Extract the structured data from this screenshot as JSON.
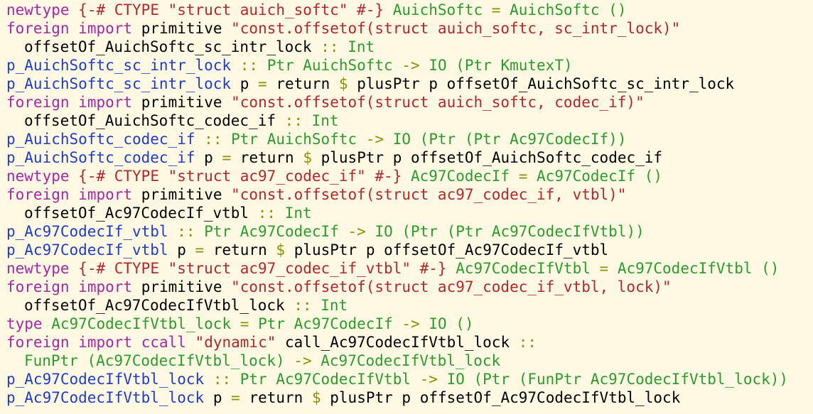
{
  "editor": {
    "lines": [
      {
        "indent": false,
        "tokens": [
          {
            "c": "kw",
            "t": "newtype"
          },
          {
            "c": "pl",
            "t": " "
          },
          {
            "c": "pr",
            "t": "{-# CTYPE \"struct auich_softc\" #-}"
          },
          {
            "c": "pl",
            "t": " "
          },
          {
            "c": "ty",
            "t": "AuichSoftc"
          },
          {
            "c": "pl",
            "t": " "
          },
          {
            "c": "op",
            "t": "="
          },
          {
            "c": "pl",
            "t": " "
          },
          {
            "c": "ty",
            "t": "AuichSoftc ()"
          }
        ]
      },
      {
        "indent": false,
        "tokens": [
          {
            "c": "kw",
            "t": "foreign"
          },
          {
            "c": "pl",
            "t": " "
          },
          {
            "c": "kw",
            "t": "import"
          },
          {
            "c": "pl",
            "t": " "
          },
          {
            "c": "id",
            "t": "primitive"
          },
          {
            "c": "pl",
            "t": " "
          },
          {
            "c": "str",
            "t": "\"const.offsetof(struct auich_softc, sc_intr_lock)\""
          }
        ]
      },
      {
        "indent": true,
        "tokens": [
          {
            "c": "id",
            "t": "offsetOf_AuichSoftc_sc_intr_lock"
          },
          {
            "c": "pl",
            "t": " "
          },
          {
            "c": "op",
            "t": "::"
          },
          {
            "c": "pl",
            "t": " "
          },
          {
            "c": "ty",
            "t": "Int"
          }
        ]
      },
      {
        "indent": false,
        "tokens": [
          {
            "c": "fn",
            "t": "p_AuichSoftc_sc_intr_lock"
          },
          {
            "c": "pl",
            "t": " "
          },
          {
            "c": "op",
            "t": "::"
          },
          {
            "c": "pl",
            "t": " "
          },
          {
            "c": "ty",
            "t": "Ptr AuichSoftc"
          },
          {
            "c": "pl",
            "t": " "
          },
          {
            "c": "op",
            "t": "->"
          },
          {
            "c": "pl",
            "t": " "
          },
          {
            "c": "ty",
            "t": "IO (Ptr KmutexT)"
          }
        ]
      },
      {
        "indent": false,
        "tokens": [
          {
            "c": "fn",
            "t": "p_AuichSoftc_sc_intr_lock"
          },
          {
            "c": "pl",
            "t": " "
          },
          {
            "c": "id",
            "t": "p"
          },
          {
            "c": "pl",
            "t": " "
          },
          {
            "c": "op",
            "t": "="
          },
          {
            "c": "pl",
            "t": " "
          },
          {
            "c": "id",
            "t": "return"
          },
          {
            "c": "pl",
            "t": " "
          },
          {
            "c": "op",
            "t": "$"
          },
          {
            "c": "pl",
            "t": " "
          },
          {
            "c": "id",
            "t": "plusPtr p offsetOf_AuichSoftc_sc_intr_lock"
          }
        ]
      },
      {
        "indent": false,
        "tokens": [
          {
            "c": "kw",
            "t": "foreign"
          },
          {
            "c": "pl",
            "t": " "
          },
          {
            "c": "kw",
            "t": "import"
          },
          {
            "c": "pl",
            "t": " "
          },
          {
            "c": "id",
            "t": "primitive"
          },
          {
            "c": "pl",
            "t": " "
          },
          {
            "c": "str",
            "t": "\"const.offsetof(struct auich_softc, codec_if)\""
          }
        ]
      },
      {
        "indent": true,
        "tokens": [
          {
            "c": "id",
            "t": "offsetOf_AuichSoftc_codec_if"
          },
          {
            "c": "pl",
            "t": " "
          },
          {
            "c": "op",
            "t": "::"
          },
          {
            "c": "pl",
            "t": " "
          },
          {
            "c": "ty",
            "t": "Int"
          }
        ]
      },
      {
        "indent": false,
        "tokens": [
          {
            "c": "fn",
            "t": "p_AuichSoftc_codec_if"
          },
          {
            "c": "pl",
            "t": " "
          },
          {
            "c": "op",
            "t": "::"
          },
          {
            "c": "pl",
            "t": " "
          },
          {
            "c": "ty",
            "t": "Ptr AuichSoftc"
          },
          {
            "c": "pl",
            "t": " "
          },
          {
            "c": "op",
            "t": "->"
          },
          {
            "c": "pl",
            "t": " "
          },
          {
            "c": "ty",
            "t": "IO (Ptr (Ptr Ac97CodecIf))"
          }
        ]
      },
      {
        "indent": false,
        "tokens": [
          {
            "c": "fn",
            "t": "p_AuichSoftc_codec_if"
          },
          {
            "c": "pl",
            "t": " "
          },
          {
            "c": "id",
            "t": "p"
          },
          {
            "c": "pl",
            "t": " "
          },
          {
            "c": "op",
            "t": "="
          },
          {
            "c": "pl",
            "t": " "
          },
          {
            "c": "id",
            "t": "return"
          },
          {
            "c": "pl",
            "t": " "
          },
          {
            "c": "op",
            "t": "$"
          },
          {
            "c": "pl",
            "t": " "
          },
          {
            "c": "id",
            "t": "plusPtr p offsetOf_AuichSoftc_codec_if"
          }
        ]
      },
      {
        "indent": false,
        "tokens": [
          {
            "c": "kw",
            "t": "newtype"
          },
          {
            "c": "pl",
            "t": " "
          },
          {
            "c": "pr",
            "t": "{-# CTYPE \"struct ac97_codec_if\" #-}"
          },
          {
            "c": "pl",
            "t": " "
          },
          {
            "c": "ty",
            "t": "Ac97CodecIf"
          },
          {
            "c": "pl",
            "t": " "
          },
          {
            "c": "op",
            "t": "="
          },
          {
            "c": "pl",
            "t": " "
          },
          {
            "c": "ty",
            "t": "Ac97CodecIf ()"
          }
        ]
      },
      {
        "indent": false,
        "tokens": [
          {
            "c": "kw",
            "t": "foreign"
          },
          {
            "c": "pl",
            "t": " "
          },
          {
            "c": "kw",
            "t": "import"
          },
          {
            "c": "pl",
            "t": " "
          },
          {
            "c": "id",
            "t": "primitive"
          },
          {
            "c": "pl",
            "t": " "
          },
          {
            "c": "str",
            "t": "\"const.offsetof(struct ac97_codec_if, vtbl)\""
          }
        ]
      },
      {
        "indent": true,
        "tokens": [
          {
            "c": "id",
            "t": "offsetOf_Ac97CodecIf_vtbl"
          },
          {
            "c": "pl",
            "t": " "
          },
          {
            "c": "op",
            "t": "::"
          },
          {
            "c": "pl",
            "t": " "
          },
          {
            "c": "ty",
            "t": "Int"
          }
        ]
      },
      {
        "indent": false,
        "tokens": [
          {
            "c": "fn",
            "t": "p_Ac97CodecIf_vtbl"
          },
          {
            "c": "pl",
            "t": " "
          },
          {
            "c": "op",
            "t": "::"
          },
          {
            "c": "pl",
            "t": " "
          },
          {
            "c": "ty",
            "t": "Ptr Ac97CodecIf"
          },
          {
            "c": "pl",
            "t": " "
          },
          {
            "c": "op",
            "t": "->"
          },
          {
            "c": "pl",
            "t": " "
          },
          {
            "c": "ty",
            "t": "IO (Ptr (Ptr Ac97CodecIfVtbl))"
          }
        ]
      },
      {
        "indent": false,
        "tokens": [
          {
            "c": "fn",
            "t": "p_Ac97CodecIf_vtbl"
          },
          {
            "c": "pl",
            "t": " "
          },
          {
            "c": "id",
            "t": "p"
          },
          {
            "c": "pl",
            "t": " "
          },
          {
            "c": "op",
            "t": "="
          },
          {
            "c": "pl",
            "t": " "
          },
          {
            "c": "id",
            "t": "return"
          },
          {
            "c": "pl",
            "t": " "
          },
          {
            "c": "op",
            "t": "$"
          },
          {
            "c": "pl",
            "t": " "
          },
          {
            "c": "id",
            "t": "plusPtr p offsetOf_Ac97CodecIf_vtbl"
          }
        ]
      },
      {
        "indent": false,
        "tokens": [
          {
            "c": "kw",
            "t": "newtype"
          },
          {
            "c": "pl",
            "t": " "
          },
          {
            "c": "pr",
            "t": "{-# CTYPE \"struct ac97_codec_if_vtbl\" #-}"
          },
          {
            "c": "pl",
            "t": " "
          },
          {
            "c": "ty",
            "t": "Ac97CodecIfVtbl"
          },
          {
            "c": "pl",
            "t": " "
          },
          {
            "c": "op",
            "t": "="
          },
          {
            "c": "pl",
            "t": " "
          },
          {
            "c": "ty",
            "t": "Ac97CodecIfVtbl ()"
          }
        ]
      },
      {
        "indent": false,
        "tokens": [
          {
            "c": "kw",
            "t": "foreign"
          },
          {
            "c": "pl",
            "t": " "
          },
          {
            "c": "kw",
            "t": "import"
          },
          {
            "c": "pl",
            "t": " "
          },
          {
            "c": "id",
            "t": "primitive"
          },
          {
            "c": "pl",
            "t": " "
          },
          {
            "c": "str",
            "t": "\"const.offsetof(struct ac97_codec_if_vtbl, lock)\""
          }
        ]
      },
      {
        "indent": true,
        "tokens": [
          {
            "c": "id",
            "t": "offsetOf_Ac97CodecIfVtbl_lock"
          },
          {
            "c": "pl",
            "t": " "
          },
          {
            "c": "op",
            "t": "::"
          },
          {
            "c": "pl",
            "t": " "
          },
          {
            "c": "ty",
            "t": "Int"
          }
        ]
      },
      {
        "indent": false,
        "tokens": [
          {
            "c": "kw",
            "t": "type"
          },
          {
            "c": "pl",
            "t": " "
          },
          {
            "c": "ty",
            "t": "Ac97CodecIfVtbl_lock"
          },
          {
            "c": "pl",
            "t": " "
          },
          {
            "c": "op",
            "t": "="
          },
          {
            "c": "pl",
            "t": " "
          },
          {
            "c": "ty",
            "t": "Ptr Ac97CodecIf"
          },
          {
            "c": "pl",
            "t": " "
          },
          {
            "c": "op",
            "t": "->"
          },
          {
            "c": "pl",
            "t": " "
          },
          {
            "c": "ty",
            "t": "IO ()"
          }
        ]
      },
      {
        "indent": false,
        "tokens": [
          {
            "c": "kw",
            "t": "foreign"
          },
          {
            "c": "pl",
            "t": " "
          },
          {
            "c": "kw",
            "t": "import"
          },
          {
            "c": "pl",
            "t": " "
          },
          {
            "c": "kw",
            "t": "ccall"
          },
          {
            "c": "pl",
            "t": " "
          },
          {
            "c": "str",
            "t": "\"dynamic\""
          },
          {
            "c": "pl",
            "t": " "
          },
          {
            "c": "id",
            "t": "call_Ac97CodecIfVtbl_lock"
          },
          {
            "c": "pl",
            "t": " "
          },
          {
            "c": "op",
            "t": "::"
          }
        ]
      },
      {
        "indent": true,
        "tokens": [
          {
            "c": "ty",
            "t": "FunPtr (Ac97CodecIfVtbl_lock)"
          },
          {
            "c": "pl",
            "t": " "
          },
          {
            "c": "op",
            "t": "->"
          },
          {
            "c": "pl",
            "t": " "
          },
          {
            "c": "ty",
            "t": "Ac97CodecIfVtbl_lock"
          }
        ]
      },
      {
        "indent": false,
        "tokens": [
          {
            "c": "fn",
            "t": "p_Ac97CodecIfVtbl_lock"
          },
          {
            "c": "pl",
            "t": " "
          },
          {
            "c": "op",
            "t": "::"
          },
          {
            "c": "pl",
            "t": " "
          },
          {
            "c": "ty",
            "t": "Ptr Ac97CodecIfVtbl"
          },
          {
            "c": "pl",
            "t": " "
          },
          {
            "c": "op",
            "t": "->"
          },
          {
            "c": "pl",
            "t": " "
          },
          {
            "c": "ty",
            "t": "IO (Ptr (FunPtr Ac97CodecIfVtbl_lock))"
          }
        ]
      },
      {
        "indent": false,
        "tokens": [
          {
            "c": "fn",
            "t": "p_Ac97CodecIfVtbl_lock"
          },
          {
            "c": "pl",
            "t": " "
          },
          {
            "c": "id",
            "t": "p"
          },
          {
            "c": "pl",
            "t": " "
          },
          {
            "c": "op",
            "t": "="
          },
          {
            "c": "pl",
            "t": " "
          },
          {
            "c": "id",
            "t": "return"
          },
          {
            "c": "pl",
            "t": " "
          },
          {
            "c": "op",
            "t": "$"
          },
          {
            "c": "pl",
            "t": " "
          },
          {
            "c": "id",
            "t": "plusPtr p offsetOf_Ac97CodecIfVtbl_lock"
          }
        ]
      }
    ]
  },
  "colors": {
    "background": "#fff9e3",
    "keyword": "#a626a4",
    "string": "#b3262c",
    "type": "#2c9b2c",
    "function": "#1f3cc8",
    "operator": "#8e8e00",
    "identifier": "#000000"
  }
}
